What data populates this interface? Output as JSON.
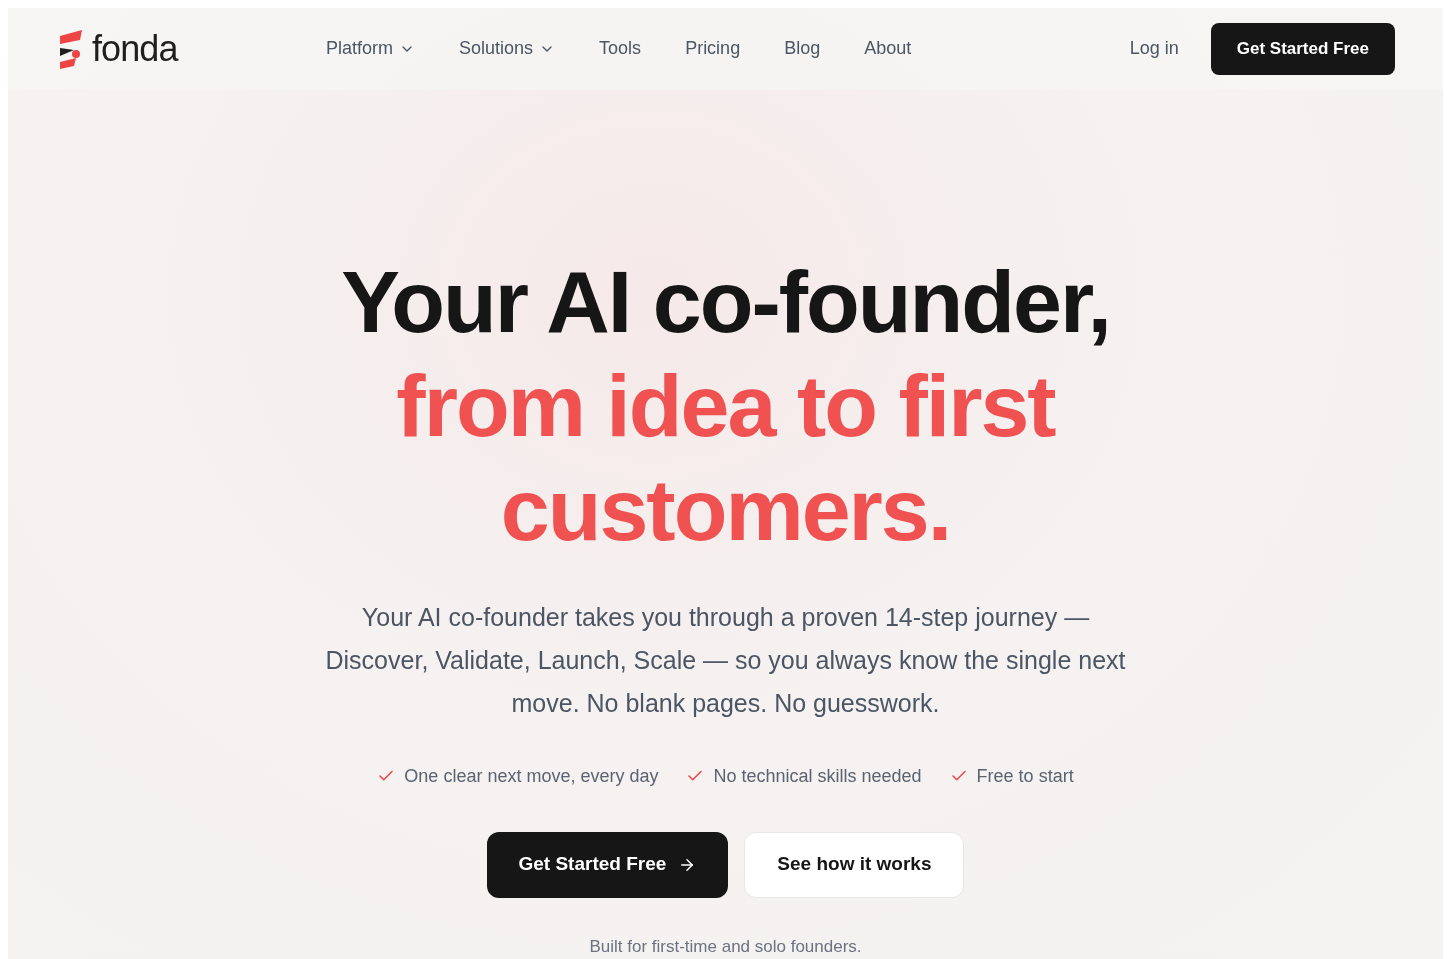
{
  "brand": {
    "name": "fonda"
  },
  "nav": [
    {
      "label": "Platform",
      "has_menu": true
    },
    {
      "label": "Solutions",
      "has_menu": true
    },
    {
      "label": "Tools",
      "has_menu": false
    },
    {
      "label": "Pricing",
      "has_menu": false
    },
    {
      "label": "Blog",
      "has_menu": false
    },
    {
      "label": "About",
      "has_menu": false
    }
  ],
  "login": "Log in",
  "header_cta": "Get Started Free",
  "headline": [
    {
      "text": "Your AI co-founder,",
      "accent": false
    },
    {
      "text": "from idea to first customers.",
      "accent": true
    }
  ],
  "subtitle": "Your AI co-founder takes you through a proven 14-step journey — Discover, Validate, Launch, Scale — so you always know the single next move. No blank pages. No guesswork.",
  "benefits": [
    "One clear next move, every day",
    "No technical skills needed",
    "Free to start"
  ],
  "primary_cta": "Get Started Free",
  "secondary_cta": "See how it works",
  "footnote": "Built for first-time and solo founders."
}
